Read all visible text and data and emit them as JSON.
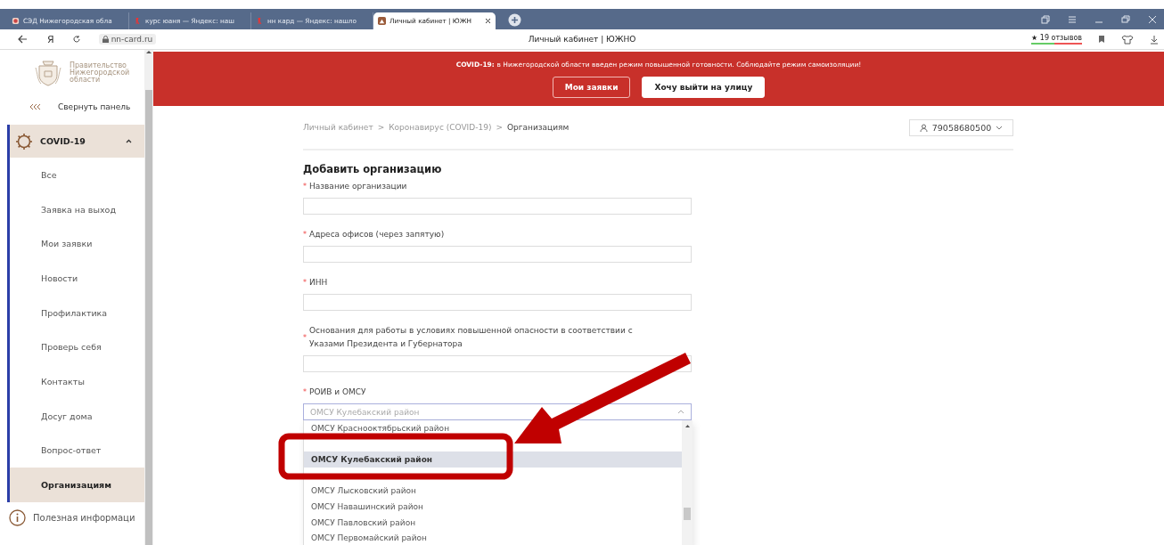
{
  "browser": {
    "tabs": [
      {
        "title": "СЭД Нижегородская обла",
        "kind": "sed",
        "selected": false
      },
      {
        "title": "курс юаня — Яндекс: наш",
        "kind": "yandex",
        "selected": false
      },
      {
        "title": "нн кард — Яндекс: нашло",
        "kind": "yandex",
        "selected": false
      },
      {
        "title": "Личный кабинет | ЮЖН",
        "kind": "site",
        "selected": true
      }
    ],
    "url": "nn-card.ru",
    "page_title": "Личный кабинет | ЮЖНО",
    "reviews": "19 отзывов",
    "reviews_star": "★",
    "home_glyph": "Я"
  },
  "sidebar": {
    "logo_text": [
      "Правительство",
      "Нижегородской",
      "области"
    ],
    "collapse": "Свернуть панель",
    "group": {
      "label": "COVID-19",
      "expanded": true,
      "items": [
        {
          "label": "Все",
          "selected": false
        },
        {
          "label": "Заявка на выход",
          "selected": false
        },
        {
          "label": "Мои заявки",
          "selected": false
        },
        {
          "label": "Новости",
          "selected": false
        },
        {
          "label": "Профилактика",
          "selected": false
        },
        {
          "label": "Проверь себя",
          "selected": false
        },
        {
          "label": "Контакты",
          "selected": false
        },
        {
          "label": "Досуг дома",
          "selected": false
        },
        {
          "label": "Вопрос-ответ",
          "selected": false
        },
        {
          "label": "Организациям",
          "selected": true
        }
      ]
    },
    "info_item": "Полезная информаци"
  },
  "banner": {
    "lead": "COVID-19:",
    "text": "в Нижегородской области введен режим повышенной готовности. Соблюдайте режим самоизоляции!",
    "buttons": [
      {
        "label": "Мои заявки",
        "kind": "outline"
      },
      {
        "label": "Хочу выйти на улицу",
        "kind": "solid"
      }
    ]
  },
  "breadcrumb": [
    "Личный кабинет",
    "Коронавирус (COVID-19)",
    "Организациям"
  ],
  "breadcrumb_separators": [
    ">",
    ">"
  ],
  "user": "79058680500",
  "form": {
    "title": "Добавить организацию",
    "fields": [
      {
        "label": "Название организации",
        "required_mark": "*",
        "kind": "text"
      },
      {
        "label": "Адреса офисов (через запятую)",
        "required_mark": "*",
        "kind": "text"
      },
      {
        "label": "ИНН",
        "required_mark": "*",
        "kind": "text"
      },
      {
        "label": "Основания для работы в условиях повышенной опасности в соответствии с Указами Президента и Губернатора",
        "required_mark": "*",
        "kind": "text"
      },
      {
        "label": "РОИВ и ОМСУ",
        "required_mark": "*",
        "kind": "select",
        "value": "ОМСУ Кулебакский район",
        "expanded": true,
        "options": [
          {
            "label": "ОМСУ Краснооктябрьский район",
            "kind": "option",
            "selected": false
          },
          {
            "kind": "covered"
          },
          {
            "label": "ОМСУ Кулебакский район",
            "kind": "option",
            "selected": true
          },
          {
            "kind": "covered"
          },
          {
            "label": "ОМСУ Лысковский район",
            "kind": "option",
            "selected": false
          },
          {
            "label": "ОМСУ Навашинский район",
            "kind": "option",
            "selected": false
          },
          {
            "label": "ОМСУ Павловский район",
            "kind": "option",
            "selected": false
          },
          {
            "label": "ОМСУ Первомайский район",
            "kind": "option",
            "selected": false
          }
        ]
      }
    ]
  }
}
